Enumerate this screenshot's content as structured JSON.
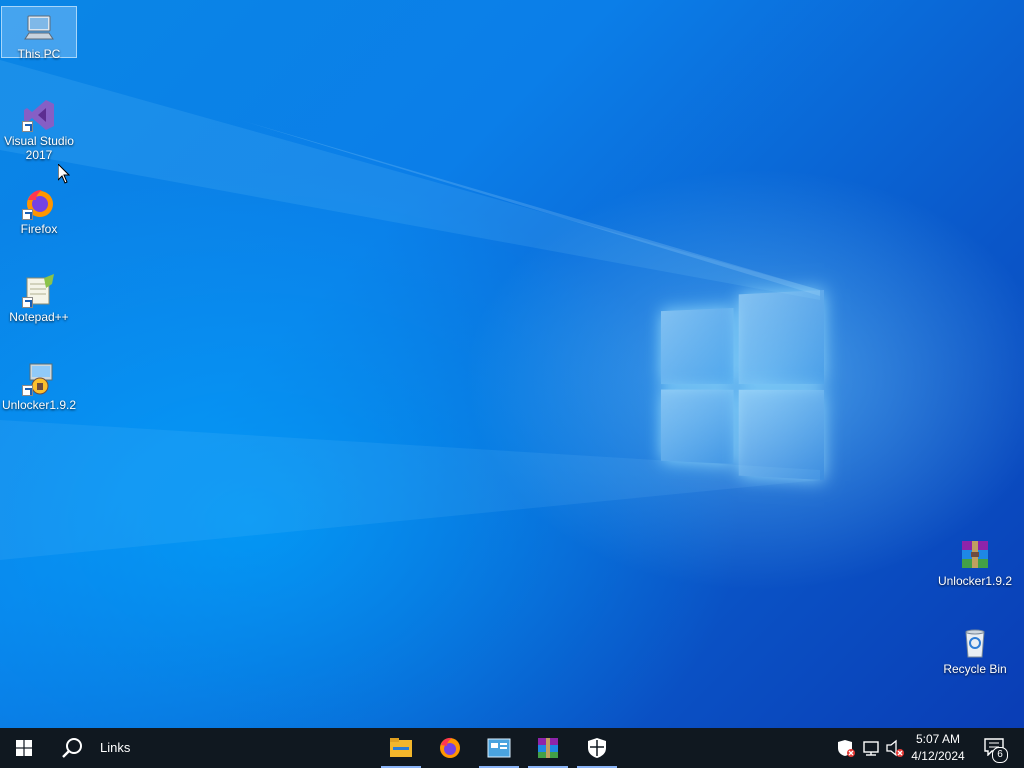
{
  "desktop": {
    "icons": [
      {
        "label": "This PC"
      },
      {
        "label": "Visual Studio 2017"
      },
      {
        "label": "Firefox"
      },
      {
        "label": "Notepad++"
      },
      {
        "label": "Unlocker1.9.2"
      },
      {
        "label": "Unlocker1.9.2"
      },
      {
        "label": "Recycle Bin"
      }
    ]
  },
  "taskbar": {
    "search_label": "Links",
    "pinned": [
      {
        "icon": "file-explorer-icon"
      },
      {
        "icon": "firefox-icon"
      },
      {
        "icon": "control-panel-icon"
      },
      {
        "icon": "winrar-icon"
      },
      {
        "icon": "windows-security-icon"
      }
    ],
    "clock": {
      "time": "5:07 AM",
      "date": "4/12/2024"
    },
    "notification_count": "6"
  },
  "colors": {
    "taskbar_bg": "#101820",
    "accent": "#8ab4f8",
    "desktop_blue": "#0a7ee8"
  }
}
